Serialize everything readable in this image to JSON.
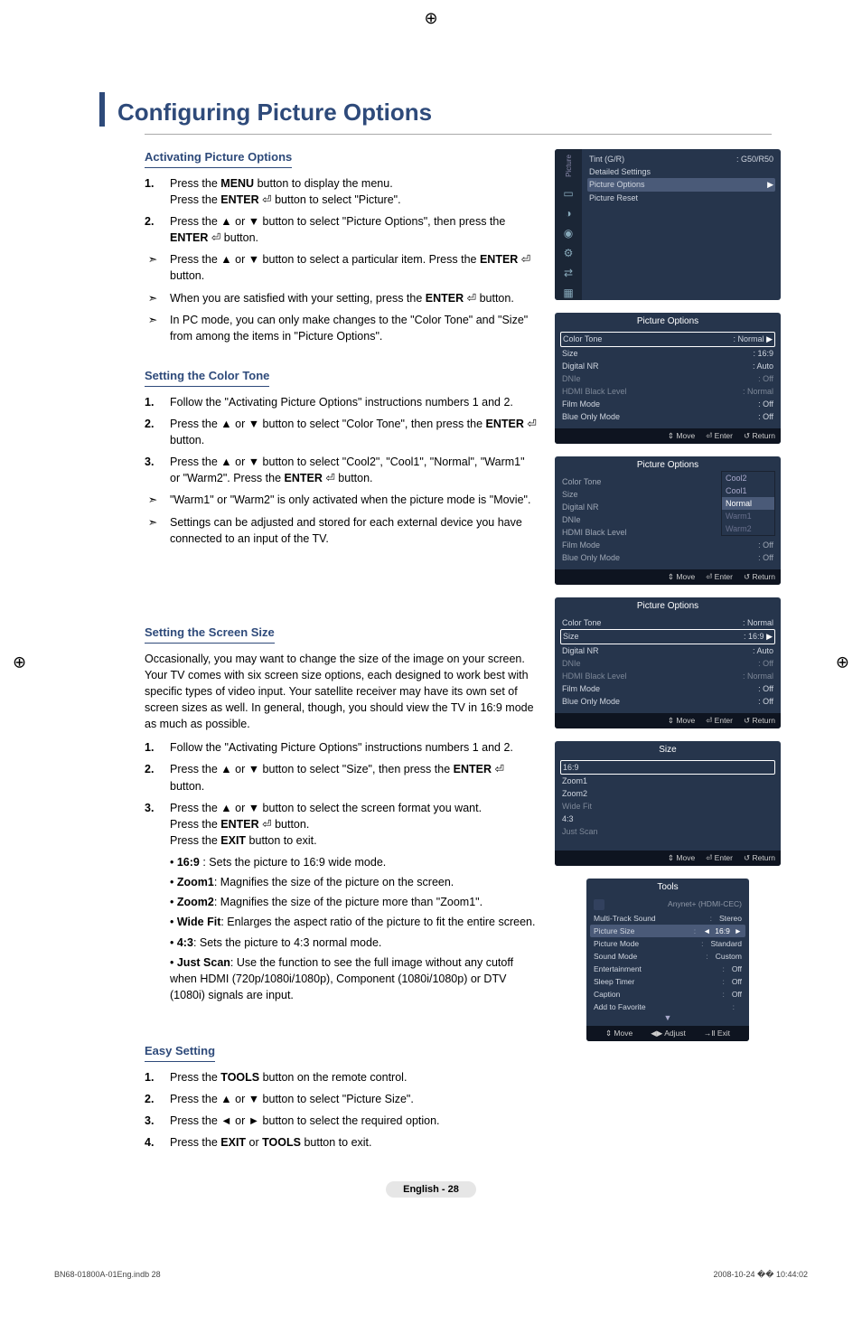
{
  "title": "Configuring Picture Options",
  "register_glyph": "⊕",
  "sections": {
    "activating": {
      "heading": "Activating Picture Options",
      "steps": [
        "Press the <b>MENU</b> button to display the menu.<br>Press the <b>ENTER</b> ⏎ button to select \"Picture\".",
        "Press the ▲ or ▼ button to select \"Picture Options\", then press the <b>ENTER</b> ⏎ button.",
        "Press the ▲ or ▼ button to select a particular item. Press the <b>ENTER</b> ⏎ button.",
        "When you are satisfied with your setting, press the <b>ENTER</b> ⏎ button.",
        "In PC mode, you can only make changes to the \"Color Tone\" and \"Size\" from among the items in \"Picture Options\"."
      ]
    },
    "color_tone": {
      "heading": "Setting the Color Tone",
      "steps": [
        "Follow the \"Activating Picture Options\" instructions numbers 1 and 2.",
        "Press the ▲ or ▼ button to select \"Color Tone\", then press the <b>ENTER</b> ⏎ button.",
        "Press the ▲ or ▼ button to select \"Cool2\", \"Cool1\", \"Normal\", \"Warm1\" or \"Warm2\". Press the <b>ENTER</b> ⏎ button."
      ],
      "notes": [
        "\"Warm1\" or \"Warm2\" is only activated when the picture mode is \"Movie\".",
        "Settings can be adjusted and stored for each external device you have connected to an input of the TV."
      ]
    },
    "screen_size": {
      "heading": "Setting the Screen Size",
      "intro": "Occasionally, you may want to change the size of the image on your screen. Your TV comes with six screen size options, each designed to work best with specific types of video input. Your satellite receiver may have its own set of screen sizes as well. In general, though, you should view the TV in 16:9 mode as much as possible.",
      "steps": [
        "Follow the \"Activating Picture Options\" instructions numbers 1 and 2.",
        "Press the ▲ or ▼ button to select \"Size\", then press the <b>ENTER</b> ⏎ button.",
        "Press the ▲ or ▼ button to select the screen format you want.<br>Press the <b>ENTER</b> ⏎ button.<br>Press the <b>EXIT</b> button to exit."
      ],
      "bullets": [
        "<b>16:9</b> : Sets the picture to 16:9 wide mode.",
        "<b>Zoom1</b>: Magnifies the size of the picture on the screen.",
        "<b>Zoom2</b>: Magnifies the size of the picture more than \"Zoom1\".",
        "<b>Wide Fit</b>: Enlarges the aspect ratio of the picture to fit the entire screen.",
        "<b>4:3</b>: Sets the picture to 4:3 normal mode.",
        "<b>Just Scan</b>: Use the function to see the full image without any cutoff when HDMI (720p/1080i/1080p), Component (1080i/1080p) or DTV (1080i) signals are input."
      ]
    },
    "easy_setting": {
      "heading": "Easy Setting",
      "steps": [
        "Press the <b>TOOLS</b> button on the remote control.",
        "Press the ▲ or ▼ button to select \"Picture Size\".",
        "Press the ◄ or ► button to select the required option.",
        "Press the <b>EXIT</b> or <b>TOOLS</b> button to exit."
      ]
    }
  },
  "osd1": {
    "side_label": "Picture",
    "tint_label": "Tint (G/R)",
    "tint_value": "G50/R50",
    "detailed": "Detailed Settings",
    "picture_options": "Picture Options",
    "picture_reset": "Picture Reset"
  },
  "osd_po_title": "Picture Options",
  "osd_rows": {
    "color_tone": "Color Tone",
    "size": "Size",
    "digital_nr": "Digital NR",
    "dnie": "DNIe",
    "hdmi_black": "HDMI Black Level",
    "film_mode": "Film Mode",
    "blue_only": "Blue Only Mode"
  },
  "osd_vals": {
    "normal": "Normal",
    "s169": "16:9",
    "auto": "Auto",
    "off": "Off"
  },
  "osd_footer": {
    "move": "⇕ Move",
    "enter": "⏎ Enter",
    "return": "↺ Return",
    "adjust": "◀▶ Adjust",
    "exit": "→Ⅱ Exit"
  },
  "dropdown": [
    "Cool2",
    "Cool1",
    "Normal",
    "Warm1",
    "Warm2"
  ],
  "osd_size_title": "Size",
  "size_opts": [
    "16:9",
    "Zoom1",
    "Zoom2",
    "Wide Fit",
    "4:3",
    "Just Scan"
  ],
  "tools": {
    "title": "Tools",
    "anynet": "Anynet+ (HDMI-CEC)",
    "rows": [
      {
        "k": "Multi-Track Sound",
        "v": "Stereo"
      },
      {
        "k": "Picture Size",
        "v": "16:9",
        "hl": true
      },
      {
        "k": "Picture Mode",
        "v": "Standard"
      },
      {
        "k": "Sound Mode",
        "v": "Custom"
      },
      {
        "k": "Entertainment",
        "v": "Off"
      },
      {
        "k": "Sleep Timer",
        "v": "Off"
      },
      {
        "k": "Caption",
        "v": "Off"
      },
      {
        "k": "Add to Favorite",
        "v": ""
      }
    ]
  },
  "page_footer": "English - 28",
  "file_footer_left": "BN68-01800A-01Eng.indb   28",
  "file_footer_right": "2008-10-24   �� 10:44:02"
}
